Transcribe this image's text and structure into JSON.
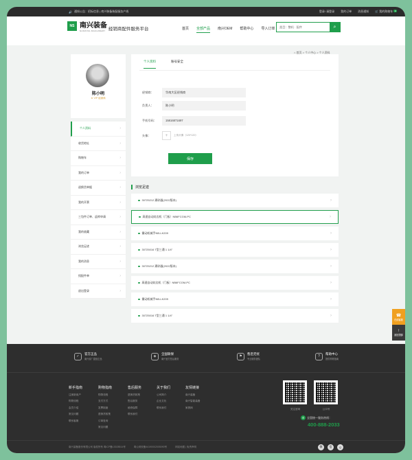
{
  "topbar": {
    "notice": "通知公告：招标信息 | 南兴装备装配服务产线",
    "links": [
      "登录/ 请登录",
      "我的订单",
      "消息通知",
      "我的购物车"
    ],
    "cart_count": "0"
  },
  "header": {
    "logo_mark": "NS",
    "brand": "南兴装备",
    "brand_sub": "NANXING MACHINERY",
    "slogan": "经销商配件服务平台",
    "nav": [
      "首页",
      "全部产品",
      "南兴OEM",
      "帮助中心",
      "导入订单"
    ],
    "search_placeholder": "类目：整机 · 配件"
  },
  "breadcrumb": "首页 > 个人中心 > 个人资料",
  "profile": {
    "name": "陈小明",
    "level": "VIP 经销商"
  },
  "sidebar": [
    "个人资料",
    "收货地址",
    "购物车",
    "我的订单",
    "退换货单据",
    "我的开票",
    "三包件订单、返库申请",
    "我的收藏",
    "浏览足迹",
    "我的消息",
    "找配件单",
    "退出登录"
  ],
  "info": {
    "tabs": [
      "个人资料",
      "账号安全"
    ],
    "fields": [
      {
        "label": "经销商：",
        "value": "华南大区经销商"
      },
      {
        "label": "负责人：",
        "value": "陈小明"
      },
      {
        "label": "手机号码：",
        "value": "15816871697"
      }
    ],
    "avatar_label": "头像：",
    "avatar_hint": "上传头像（120*120）",
    "save_label": "保存"
  },
  "recent": {
    "title": "浏览足迹",
    "items": [
      "30725212 建砂器(2022版本)",
      "高速自动封边机（门板）NB6FCGM-PC",
      "撤动机械手NB-LK209",
      "30725016 T型三通 1 1/4\"",
      "30725212 建砂器(2022版本)",
      "高速自动封边机（门板）NB6FCGM-PC",
      "撤动机械手NB-LK209",
      "30725016 T型三通 1 1/4\""
    ]
  },
  "float": [
    {
      "icon": "☎",
      "label": "在线客服"
    },
    {
      "icon": "↑",
      "label": "返回顶部"
    }
  ],
  "guarantees": [
    {
      "title": "官方正品",
      "sub": "南兴原厂直营正品"
    },
    {
      "title": "全国联保",
      "sub": "南兴官方售后服务"
    },
    {
      "title": "售后无忧",
      "sub": "专业服务团队"
    },
    {
      "title": "帮助中心",
      "sub": "提供购物指南"
    }
  ],
  "footer_cols": [
    {
      "title": "新手指南",
      "links": [
        "注册新用户",
        "购物流程",
        "会员介绍",
        "常见问题",
        "联系客服"
      ]
    },
    {
      "title": "购物指南",
      "links": [
        "购物流程",
        "支付方式",
        "发票制度",
        "退换货政策",
        "订单查询",
        "常见问题"
      ]
    },
    {
      "title": "售后服务",
      "links": [
        "退换货政策",
        "售后服务",
        "维修保障",
        "联系我们"
      ]
    },
    {
      "title": "关于我们",
      "links": [
        "公司简介",
        "企业文化",
        "联系我们"
      ]
    },
    {
      "title": "友情链接",
      "links": [
        "南兴装备",
        "南兴智能装备",
        "家具网"
      ]
    }
  ],
  "qr": [
    {
      "label": "关注官网"
    },
    {
      "label": "公众号"
    }
  ],
  "hotline_label": "全国统一服务热线：",
  "hotline": "400-888-2033",
  "copyright": "南兴装备股份有限公司 版权所有  粤ICP备13028514号",
  "police": "粤公网安备44190002005090号",
  "statement": "网站地图 | 免责声明",
  "colors": {
    "accent": "#1f9e4b",
    "footer": "#2e2e2e",
    "float": "#f0a020"
  }
}
